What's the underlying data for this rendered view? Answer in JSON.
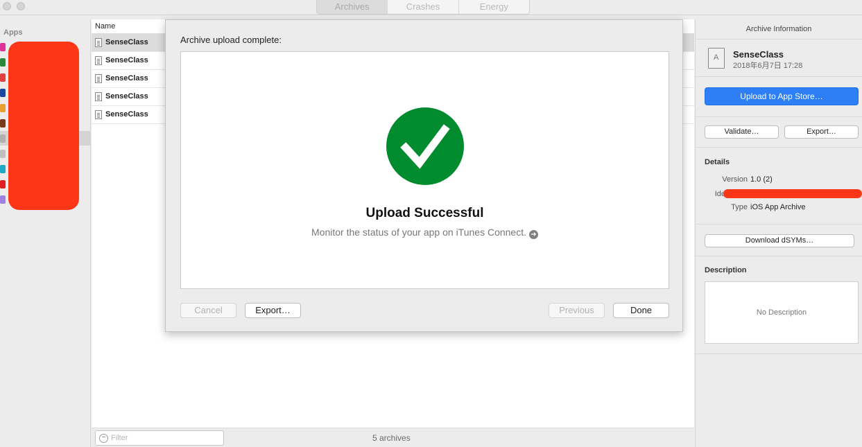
{
  "titlebar": {
    "tabs": [
      {
        "label": "Archives"
      },
      {
        "label": "Crashes"
      },
      {
        "label": "Energy"
      }
    ]
  },
  "sidebar": {
    "heading": "Apps"
  },
  "list": {
    "column_name": "Name",
    "rows": [
      {
        "name": "SenseClass"
      },
      {
        "name": "SenseClass"
      },
      {
        "name": "SenseClass"
      },
      {
        "name": "SenseClass"
      },
      {
        "name": "SenseClass"
      }
    ],
    "filter_placeholder": "Filter",
    "count": "5 archives"
  },
  "inspector": {
    "title": "Archive Information",
    "app_name": "SenseClass",
    "app_date": "2018年6月7日 17:28",
    "upload_button": "Upload to App Store…",
    "validate_button": "Validate…",
    "export_button": "Export…",
    "details_heading": "Details",
    "version_label": "Version",
    "version_value": "1.0 (2)",
    "identifier_label": "Ide",
    "type_label": "Type",
    "type_value": "iOS App Archive",
    "dsyms_button": "Download dSYMs…",
    "description_heading": "Description",
    "description_text": "No Description"
  },
  "sheet": {
    "title": "Archive upload complete:",
    "success_title": "Upload Successful",
    "success_subtitle": "Monitor the status of your app on iTunes Connect.",
    "cancel": "Cancel",
    "export": "Export…",
    "previous": "Previous",
    "done": "Done"
  },
  "colors": {
    "success_green": "#008c2e",
    "primary_blue": "#2e7ff6",
    "redaction_red": "#fe3618"
  }
}
